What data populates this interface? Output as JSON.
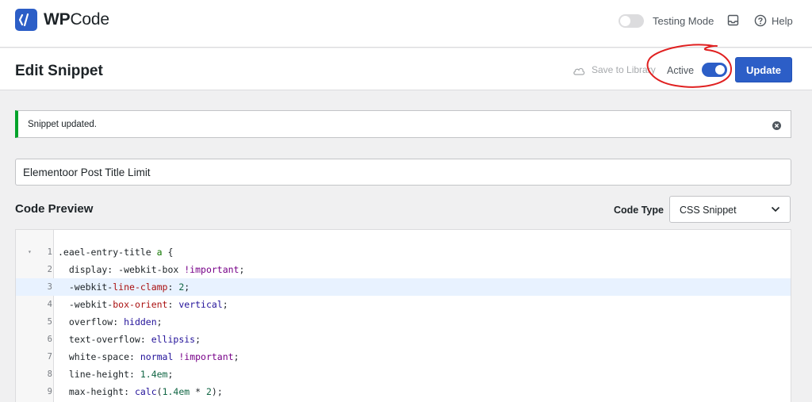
{
  "app": {
    "logo_bold": "WP",
    "logo_rest": "Code"
  },
  "topbar": {
    "testing_mode_label": "Testing Mode",
    "testing_mode_on": false,
    "help_label": "Help"
  },
  "header": {
    "title": "Edit Snippet",
    "save_to_library": "Save to Library",
    "active_label": "Active",
    "active_on": true,
    "update_label": "Update"
  },
  "notice": {
    "text": "Snippet updated."
  },
  "snippet": {
    "title_value": "Elementoor Post Title Limit"
  },
  "preview": {
    "title": "Code Preview",
    "code_type_label": "Code Type",
    "code_type_value": "CSS Snippet"
  },
  "code": {
    "highlighted_line": 3,
    "lines": [
      {
        "n": "1",
        "text": ".eael-entry-title a {"
      },
      {
        "n": "2",
        "text": "  display: -webkit-box !important;"
      },
      {
        "n": "3",
        "text": "  -webkit-line-clamp: 2;"
      },
      {
        "n": "4",
        "text": "  -webkit-box-orient: vertical;"
      },
      {
        "n": "5",
        "text": "  overflow: hidden;"
      },
      {
        "n": "6",
        "text": "  text-overflow: ellipsis;"
      },
      {
        "n": "7",
        "text": "  white-space: normal !important;"
      },
      {
        "n": "8",
        "text": "  line-height: 1.4em;"
      },
      {
        "n": "9",
        "text": "  max-height: calc(1.4em * 2);"
      }
    ]
  },
  "colors": {
    "accent": "#2c5ec7",
    "success": "#00a32a",
    "annotation": "#e02020"
  }
}
